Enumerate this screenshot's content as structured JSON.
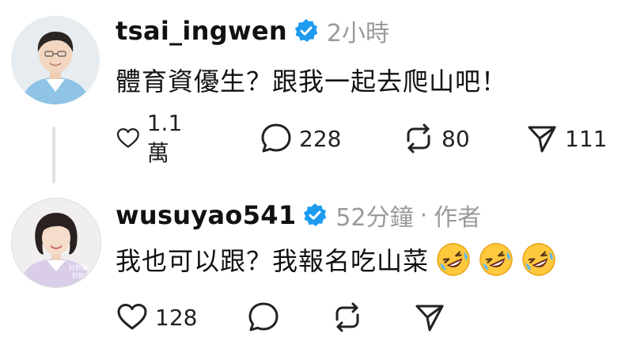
{
  "posts": [
    {
      "username": "tsai_ingwen",
      "time": "2小時",
      "text": "體育資優生？跟我一起去爬山吧！",
      "actions": {
        "likes": "1.1萬",
        "comments": "228",
        "reposts": "80",
        "shares": "111"
      }
    },
    {
      "username": "wusuyao541",
      "time": "52分鐘",
      "separator": "·",
      "role": "作者",
      "text": "我也可以跟？我報名吃山菜",
      "emojis": [
        "rolling-on-floor-laughing",
        "rolling-on-floor-laughing",
        "rolling-on-floor-laughing"
      ],
      "avatar_badge": "好鈴事 好鈴事",
      "actions": {
        "likes": "128"
      }
    }
  ],
  "colors": {
    "verified": "#1d9bf0",
    "meta": "#9a9a9a",
    "text": "#111111",
    "thread_line": "#e3e3e3"
  }
}
